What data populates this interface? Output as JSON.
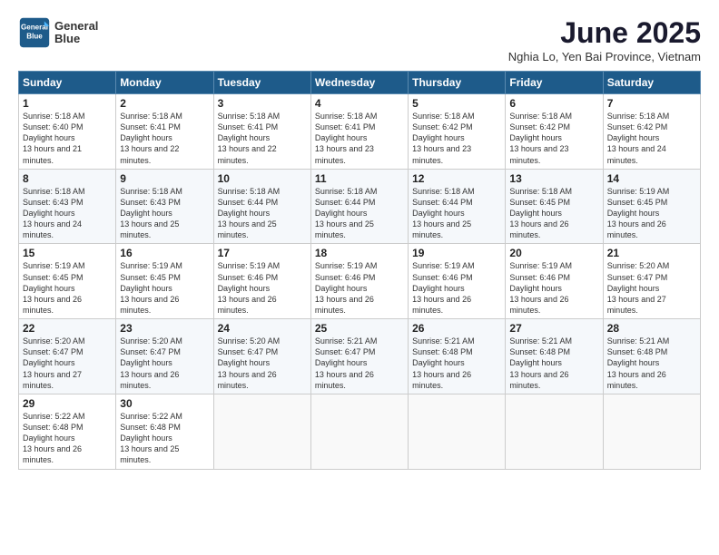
{
  "logo": {
    "line1": "General",
    "line2": "Blue"
  },
  "title": "June 2025",
  "subtitle": "Nghia Lo, Yen Bai Province, Vietnam",
  "weekdays": [
    "Sunday",
    "Monday",
    "Tuesday",
    "Wednesday",
    "Thursday",
    "Friday",
    "Saturday"
  ],
  "weeks": [
    [
      {
        "day": "1",
        "sunrise": "5:18 AM",
        "sunset": "6:40 PM",
        "daylight": "13 hours and 21 minutes."
      },
      {
        "day": "2",
        "sunrise": "5:18 AM",
        "sunset": "6:41 PM",
        "daylight": "13 hours and 22 minutes."
      },
      {
        "day": "3",
        "sunrise": "5:18 AM",
        "sunset": "6:41 PM",
        "daylight": "13 hours and 22 minutes."
      },
      {
        "day": "4",
        "sunrise": "5:18 AM",
        "sunset": "6:41 PM",
        "daylight": "13 hours and 23 minutes."
      },
      {
        "day": "5",
        "sunrise": "5:18 AM",
        "sunset": "6:42 PM",
        "daylight": "13 hours and 23 minutes."
      },
      {
        "day": "6",
        "sunrise": "5:18 AM",
        "sunset": "6:42 PM",
        "daylight": "13 hours and 23 minutes."
      },
      {
        "day": "7",
        "sunrise": "5:18 AM",
        "sunset": "6:42 PM",
        "daylight": "13 hours and 24 minutes."
      }
    ],
    [
      {
        "day": "8",
        "sunrise": "5:18 AM",
        "sunset": "6:43 PM",
        "daylight": "13 hours and 24 minutes."
      },
      {
        "day": "9",
        "sunrise": "5:18 AM",
        "sunset": "6:43 PM",
        "daylight": "13 hours and 25 minutes."
      },
      {
        "day": "10",
        "sunrise": "5:18 AM",
        "sunset": "6:44 PM",
        "daylight": "13 hours and 25 minutes."
      },
      {
        "day": "11",
        "sunrise": "5:18 AM",
        "sunset": "6:44 PM",
        "daylight": "13 hours and 25 minutes."
      },
      {
        "day": "12",
        "sunrise": "5:18 AM",
        "sunset": "6:44 PM",
        "daylight": "13 hours and 25 minutes."
      },
      {
        "day": "13",
        "sunrise": "5:18 AM",
        "sunset": "6:45 PM",
        "daylight": "13 hours and 26 minutes."
      },
      {
        "day": "14",
        "sunrise": "5:19 AM",
        "sunset": "6:45 PM",
        "daylight": "13 hours and 26 minutes."
      }
    ],
    [
      {
        "day": "15",
        "sunrise": "5:19 AM",
        "sunset": "6:45 PM",
        "daylight": "13 hours and 26 minutes."
      },
      {
        "day": "16",
        "sunrise": "5:19 AM",
        "sunset": "6:45 PM",
        "daylight": "13 hours and 26 minutes."
      },
      {
        "day": "17",
        "sunrise": "5:19 AM",
        "sunset": "6:46 PM",
        "daylight": "13 hours and 26 minutes."
      },
      {
        "day": "18",
        "sunrise": "5:19 AM",
        "sunset": "6:46 PM",
        "daylight": "13 hours and 26 minutes."
      },
      {
        "day": "19",
        "sunrise": "5:19 AM",
        "sunset": "6:46 PM",
        "daylight": "13 hours and 26 minutes."
      },
      {
        "day": "20",
        "sunrise": "5:19 AM",
        "sunset": "6:46 PM",
        "daylight": "13 hours and 26 minutes."
      },
      {
        "day": "21",
        "sunrise": "5:20 AM",
        "sunset": "6:47 PM",
        "daylight": "13 hours and 27 minutes."
      }
    ],
    [
      {
        "day": "22",
        "sunrise": "5:20 AM",
        "sunset": "6:47 PM",
        "daylight": "13 hours and 27 minutes."
      },
      {
        "day": "23",
        "sunrise": "5:20 AM",
        "sunset": "6:47 PM",
        "daylight": "13 hours and 26 minutes."
      },
      {
        "day": "24",
        "sunrise": "5:20 AM",
        "sunset": "6:47 PM",
        "daylight": "13 hours and 26 minutes."
      },
      {
        "day": "25",
        "sunrise": "5:21 AM",
        "sunset": "6:47 PM",
        "daylight": "13 hours and 26 minutes."
      },
      {
        "day": "26",
        "sunrise": "5:21 AM",
        "sunset": "6:48 PM",
        "daylight": "13 hours and 26 minutes."
      },
      {
        "day": "27",
        "sunrise": "5:21 AM",
        "sunset": "6:48 PM",
        "daylight": "13 hours and 26 minutes."
      },
      {
        "day": "28",
        "sunrise": "5:21 AM",
        "sunset": "6:48 PM",
        "daylight": "13 hours and 26 minutes."
      }
    ],
    [
      {
        "day": "29",
        "sunrise": "5:22 AM",
        "sunset": "6:48 PM",
        "daylight": "13 hours and 26 minutes."
      },
      {
        "day": "30",
        "sunrise": "5:22 AM",
        "sunset": "6:48 PM",
        "daylight": "13 hours and 25 minutes."
      },
      null,
      null,
      null,
      null,
      null
    ]
  ]
}
